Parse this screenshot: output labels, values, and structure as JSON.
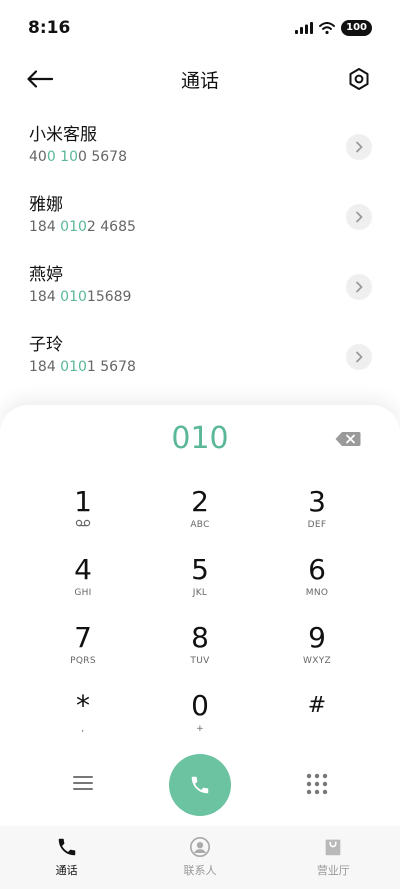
{
  "status": {
    "time": "8:16",
    "battery": "100"
  },
  "header": {
    "title": "通话"
  },
  "contacts": [
    {
      "name": "小米客服",
      "num_pre": "40",
      "num_hl": "0 10",
      "num_post": "0 5678"
    },
    {
      "name": "雅娜",
      "num_pre": "184 ",
      "num_hl": "010",
      "num_post": "2 4685"
    },
    {
      "name": "燕婷",
      "num_pre": "184 ",
      "num_hl": "010",
      "num_post": "15689"
    },
    {
      "name": "子玲",
      "num_pre": "184 ",
      "num_hl": "010",
      "num_post": "1 5678"
    }
  ],
  "dialpad": {
    "display": "010",
    "keys": [
      {
        "digit": "1",
        "sub": ""
      },
      {
        "digit": "2",
        "sub": "ABC"
      },
      {
        "digit": "3",
        "sub": "DEF"
      },
      {
        "digit": "4",
        "sub": "GHI"
      },
      {
        "digit": "5",
        "sub": "JKL"
      },
      {
        "digit": "6",
        "sub": "MNO"
      },
      {
        "digit": "7",
        "sub": "PQRS"
      },
      {
        "digit": "8",
        "sub": "TUV"
      },
      {
        "digit": "9",
        "sub": "WXYZ"
      },
      {
        "digit": "*",
        "sub": ","
      },
      {
        "digit": "0",
        "sub": "+"
      },
      {
        "digit": "#",
        "sub": ""
      }
    ]
  },
  "nav": [
    {
      "label": "通话",
      "icon": "phone-icon"
    },
    {
      "label": "联系人",
      "icon": "contact-icon"
    },
    {
      "label": "营业厅",
      "icon": "store-bag-icon"
    }
  ],
  "colors": {
    "accent": "#5ab896",
    "call_button": "#6cc3a1"
  }
}
